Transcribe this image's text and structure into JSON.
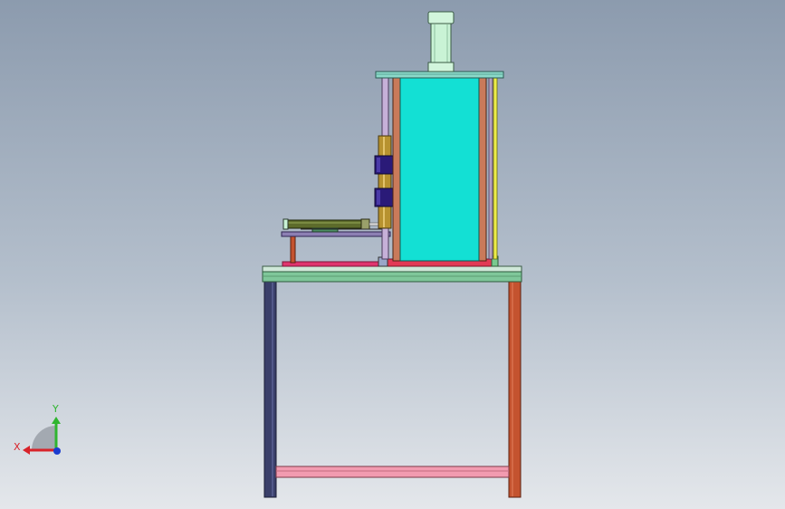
{
  "viewport": {
    "background_top": "#8c9bae",
    "background_bottom": "#e4e7eb"
  },
  "triad": {
    "x_label": "X",
    "y_label": "Y",
    "x_color": "#d8232a",
    "y_color": "#2fb52f",
    "z_color": "#1b3ccf"
  },
  "colors": {
    "cylinder_body": "#13e0d4",
    "cylinder_rod_cap": "#c9f3d5",
    "top_plate": "#8cd9c9",
    "rail_left": "#c6b0d8",
    "rail_right": "#ecec4a",
    "spring_brass": "#b7922f",
    "block_dark": "#2a1a78",
    "table_top": "#7fc79a",
    "leg_left": "#3a3f6a",
    "leg_right": "#c4532f",
    "crossbar": "#f29bb0",
    "base_plate": "#e0356e"
  }
}
